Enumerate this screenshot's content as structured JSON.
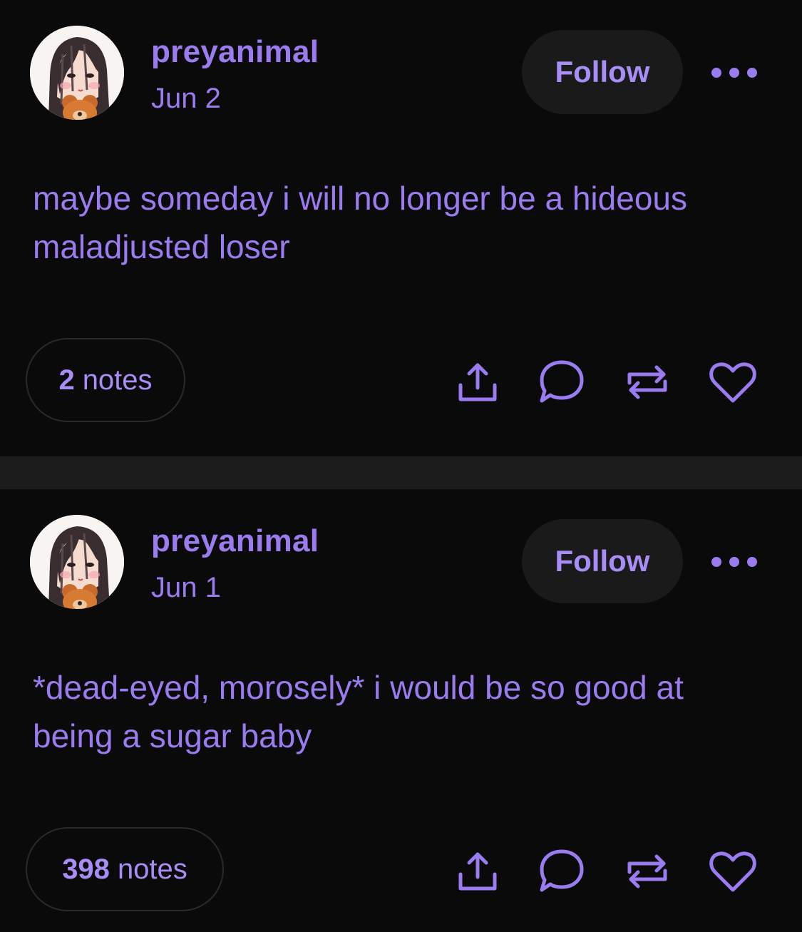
{
  "colors": {
    "accent": "#9b7cf0",
    "background": "#0a0a0b",
    "divider": "#1b1b1c",
    "follow_button_bg": "#1a1a1b"
  },
  "posts": [
    {
      "username": "preyanimal",
      "date": "Jun 2",
      "follow_label": "Follow",
      "body": "maybe someday i will no longer be a hideous maladjusted loser",
      "notes_count": "2",
      "notes_label": "notes",
      "icons": [
        "share-icon",
        "comment-icon",
        "reblog-icon",
        "like-icon"
      ]
    },
    {
      "username": "preyanimal",
      "date": "Jun 1",
      "follow_label": "Follow",
      "body": "*dead-eyed, morosely* i would be so good at being a sugar baby",
      "notes_count": "398",
      "notes_label": "notes",
      "icons": [
        "share-icon",
        "comment-icon",
        "reblog-icon",
        "like-icon"
      ]
    }
  ]
}
